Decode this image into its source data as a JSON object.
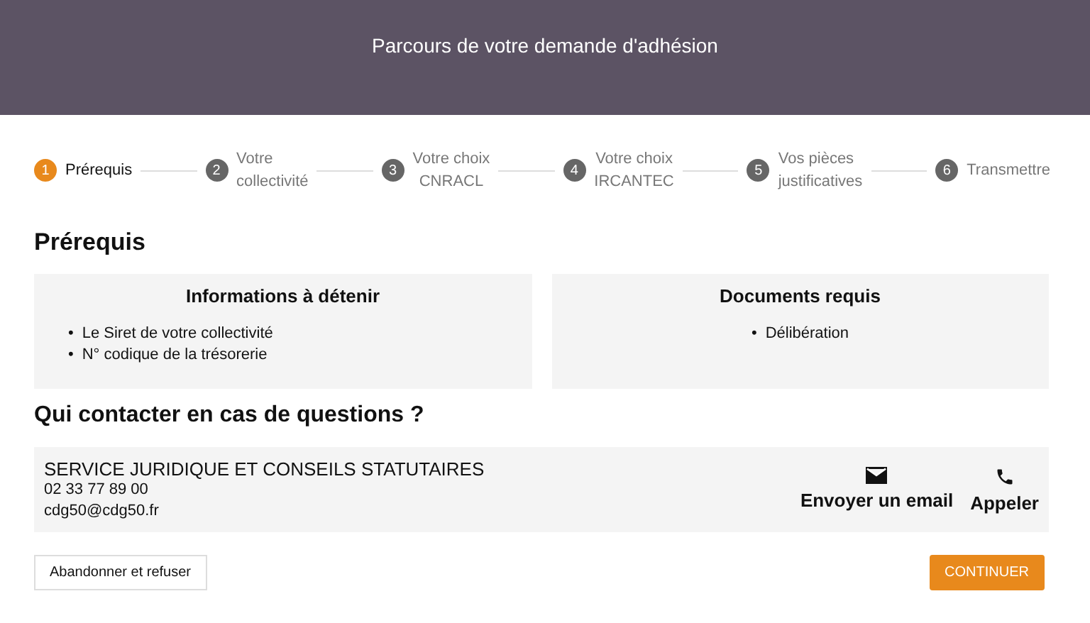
{
  "header": {
    "title": "Parcours de votre demande d'adhésion"
  },
  "steps": [
    {
      "number": "1",
      "label": "Prérequis",
      "selected": true
    },
    {
      "number": "2",
      "label": "Votre\ncollectivité",
      "selected": false
    },
    {
      "number": "3",
      "label": "Votre choix\nCNRACL",
      "selected": false
    },
    {
      "number": "4",
      "label": "Votre choix\nIRCANTEC",
      "selected": false
    },
    {
      "number": "5",
      "label": "Vos pièces\njustificatives",
      "selected": false
    },
    {
      "number": "6",
      "label": "Transmettre",
      "selected": false
    }
  ],
  "section_title": "Prérequis",
  "cards": [
    {
      "title": "Informations à détenir",
      "bullet": "•",
      "items": [
        "Le Siret de votre collectivité",
        "N° codique de la trésorerie"
      ]
    },
    {
      "title": "Documents requis",
      "bullet": "•",
      "items": [
        "Délibération"
      ]
    }
  ],
  "contact_title": "Qui contacter en cas de questions ?",
  "contact": {
    "name": "SERVICE JURIDIQUE ET CONSEILS STATUTAIRES",
    "phone": "02 33 77 89 00",
    "email": "cdg50@cdg50.fr",
    "actions": [
      {
        "kind": "email",
        "label": "Envoyer un email"
      },
      {
        "kind": "phone",
        "label": "Appeler"
      }
    ]
  },
  "buttons": {
    "cancel": "Abandonner et refuser",
    "continue": "CONTINUER"
  }
}
